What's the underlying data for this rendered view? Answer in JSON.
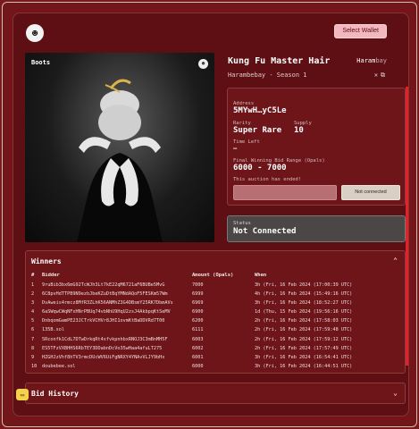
{
  "header": {
    "select_wallet_label": "Select Wallet"
  },
  "art": {
    "label": "Boots"
  },
  "item": {
    "title": "Kung Fu Master Hair",
    "collection": "Harambebay - Season 1",
    "brand_main": "Haram",
    "brand_suffix": "bay"
  },
  "auction": {
    "address_label": "Address",
    "address_value": "5MYwH…yC5Le",
    "rarity_label": "Rarity",
    "rarity_value": "Super Rare",
    "supply_label": "Supply",
    "supply_value": "10",
    "time_left_label": "Time Left",
    "time_left_value": "—",
    "range_label": "Final Winning Bid Range (Opals)",
    "range_value": "6000 - 7000",
    "ended_text": "This auction has ended!",
    "not_connected_label": "Not connected"
  },
  "status": {
    "label": "Status",
    "value": "Not Connected"
  },
  "winners": {
    "title": "Winners",
    "columns": [
      "#",
      "Bidder",
      "Amount (Opals)",
      "When"
    ],
    "rows": [
      [
        "1",
        "9ruBib3bx6mG92TcWJh3Lt7kE22qM6721aF6BUBe5MvG",
        "7000",
        "3h (Fri, 16 Feb 2024 (17:00:39 UTC)"
      ],
      [
        "2",
        "6C8pvHdTTPB9N9ezbJbeKZuDtBqYMNdAQoF5FESKm57Wm",
        "6999",
        "4h (Fri, 16 Feb 2024 (15:49:16 UTC)"
      ],
      [
        "3",
        "DvAweis4rmcz8MfR3ZLhK56ANMhZ3G4DBsmY25RK7DbmAVs",
        "6969",
        "3h (Fri, 16 Feb 2024 (18:52:27 UTC)"
      ],
      [
        "4",
        "6aSWqwCWqNFxHNrPBUq74vbNhU9HqU2zsJ4AkbpqKtSeMV",
        "6900",
        "1d (Thu, 15 Feb 2024 (19:56:16 UTC)"
      ],
      [
        "5",
        "DnbqomGamPE23JCTrkVCHVr8JHI1ovmKtBaDDVRd7T00",
        "6200",
        "2h (Fri, 16 Feb 2024 (17:58:03 UTC)"
      ],
      [
        "6",
        "135B.sol",
        "6111",
        "2h (Fri, 16 Feb 2024 (17:59:48 UTC)"
      ],
      [
        "7",
        "5Rconfk1CdL7DTwDrkqRt4xfvkpnhbxRNOJ3C3mBnMH5F",
        "6003",
        "2h (Fri, 16 Feb 2024 (17:59:12 UTC)"
      ],
      [
        "8",
        "ES5TFzVXBHHS6RbTEY3DDabnDcVo35wHaa4afuLT275",
        "6002",
        "2h (Fri, 16 Feb 2024 (17:57:49 UTC)"
      ],
      [
        "9",
        "HZGHJzVhf8hTV3rmcDUcWV6UiFgNRXY4YNAvVLJY9bHx",
        "6001",
        "3h (Fri, 16 Feb 2024 (16:54:41 UTC)"
      ],
      [
        "10",
        "doubebee.sol",
        "6000",
        "3h (Fri, 16 Feb 2024 (16:44:51 UTC)"
      ]
    ]
  },
  "bid_history": {
    "title": "Bid History"
  },
  "colors": {
    "background": "#7a1a1d",
    "card": "#5e0f13",
    "panel": "#6d1519",
    "accent": "#e0222a",
    "wallet_button": "#f3b8bf",
    "status_panel": "#4b4747",
    "chat_button": "#f2d34a"
  },
  "icons": {
    "logo": "monkey-logo-icon",
    "collapse": "chevron-up-icon",
    "expand": "chevron-down-icon",
    "chat": "chat-icon"
  }
}
